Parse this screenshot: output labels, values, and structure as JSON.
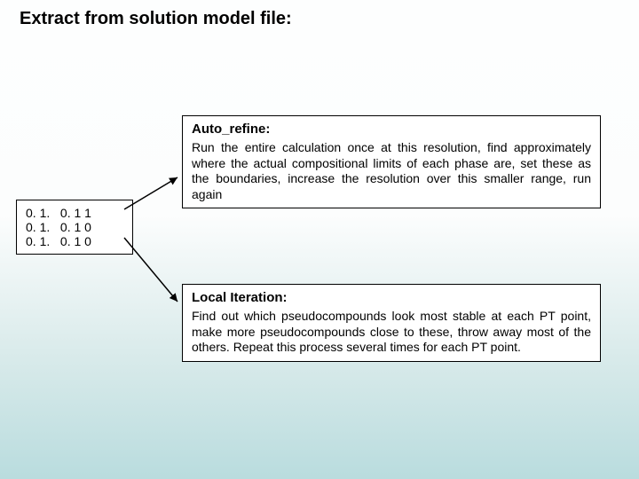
{
  "title": "Extract from solution model file:",
  "left_data": {
    "rows": [
      "0. 1.   0. 1 1",
      "0. 1.   0. 1 0",
      "0. 1.   0. 1 0"
    ]
  },
  "box1": {
    "header": "Auto_refine:",
    "body": "Run the entire calculation once at this resolution, find approximately where the actual compositional limits of each phase are, set these as the boundaries, increase the resolution over this smaller range, run again"
  },
  "box2": {
    "header": "Local Iteration:",
    "body": "Find out which pseudocompounds look most stable at each PT point, make more pseudocompounds close to these, throw away most of the others. Repeat this process several times for each PT point."
  }
}
